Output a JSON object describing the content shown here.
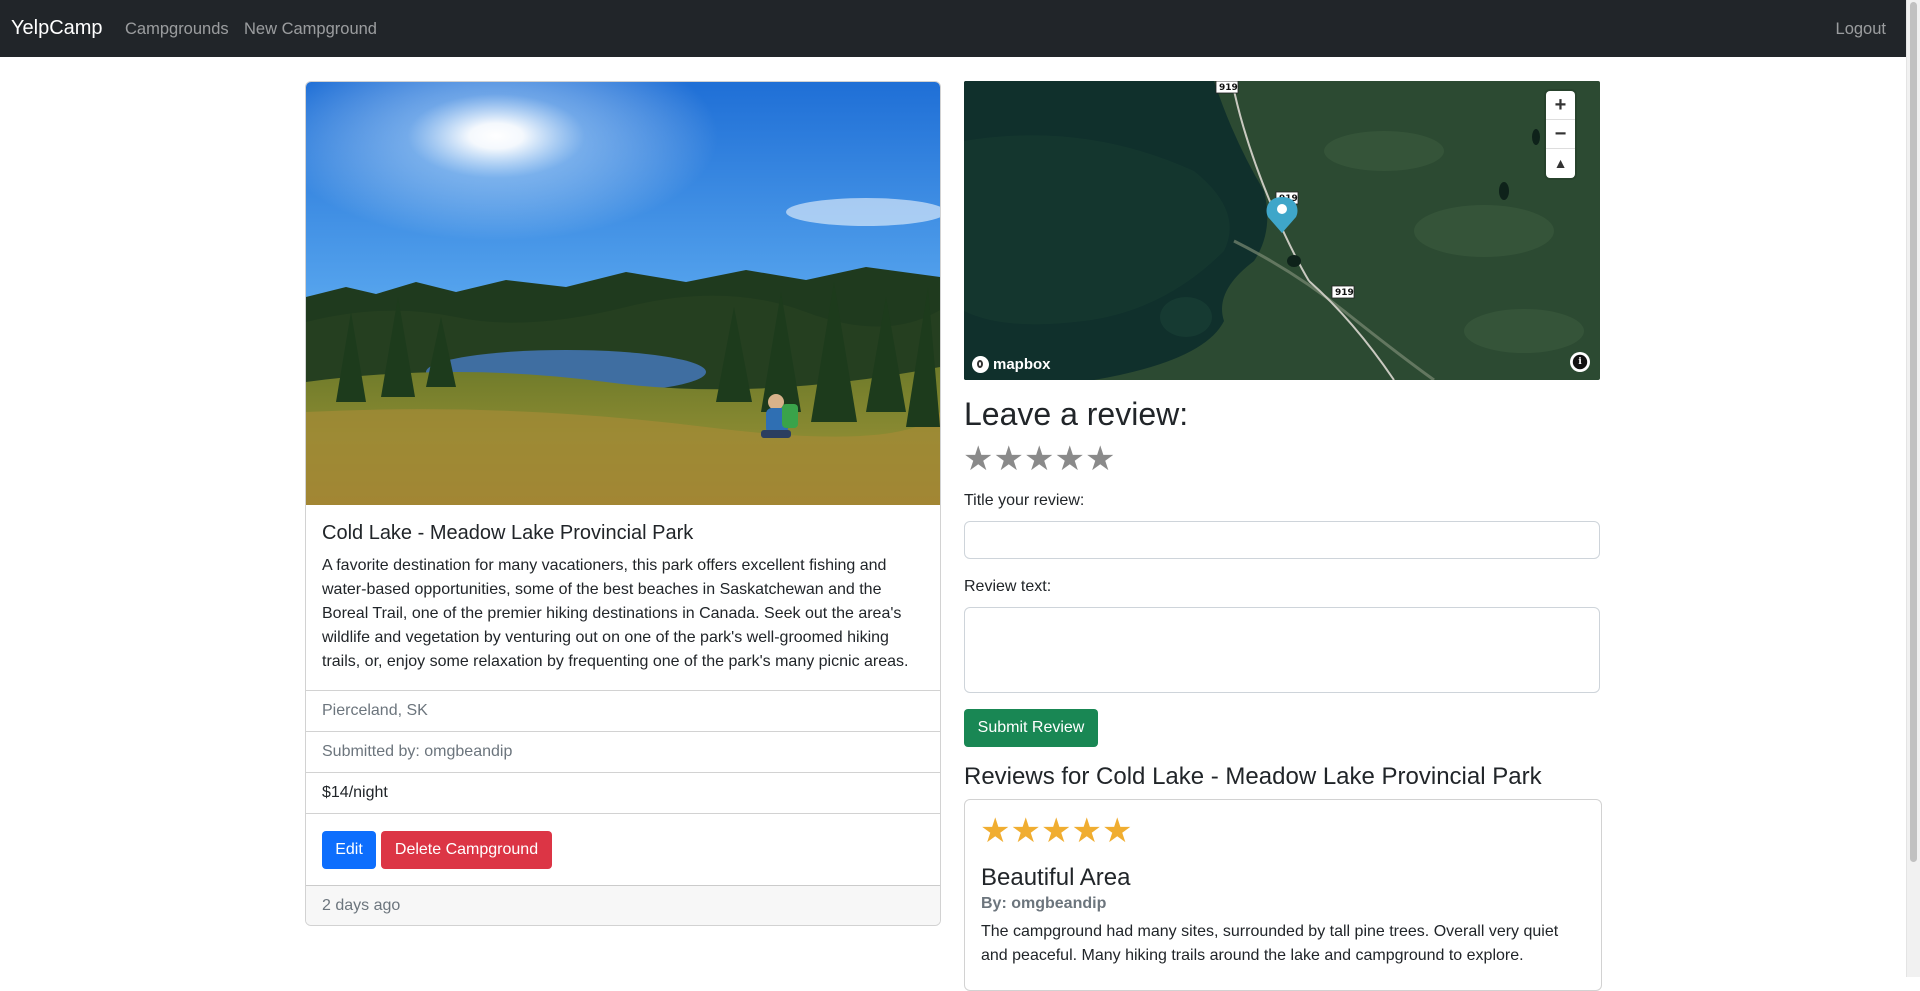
{
  "navbar": {
    "brand": "YelpCamp",
    "links": [
      "Campgrounds",
      "New Campground"
    ],
    "logout": "Logout"
  },
  "campground": {
    "title": "Cold Lake - Meadow Lake Provincial Park",
    "description": "A favorite destination for many vacationers, this park offers excellent fishing and water-based opportunities, some of the best beaches in Saskatchewan and the Boreal Trail, one of the premier hiking destinations in Canada. Seek out the area's wildlife and vegetation by venturing out on one of the park's well-groomed hiking trails, or, enjoy some relaxation by frequenting one of the park's many picnic areas.",
    "location": "Pierceland, SK",
    "submitted_by": "Submitted by: omgbeandip",
    "price": "$14/night",
    "edit_label": "Edit",
    "delete_label": "Delete Campground",
    "footer": "2 days ago"
  },
  "map": {
    "zoom_in": "+",
    "zoom_out": "−",
    "reset_north": "▲",
    "attribution": "mapbox",
    "road_labels": [
      "919",
      "919",
      "919"
    ]
  },
  "review_form": {
    "heading": "Leave a review:",
    "rating_stars": [
      "★",
      "★",
      "★",
      "★",
      "★"
    ],
    "title_label": "Title your review:",
    "text_label": "Review text:",
    "submit_label": "Submit Review"
  },
  "reviews": {
    "heading": "Reviews for Cold Lake - Meadow Lake Provincial Park",
    "items": [
      {
        "rating": 5,
        "stars": [
          "★",
          "★",
          "★",
          "★",
          "★"
        ],
        "title": "Beautiful Area",
        "author": "By: omgbeandip",
        "text": "The campground had many sites, surrounded by tall pine trees. Overall very quiet and peaceful. Many hiking trails around the lake and campground to explore."
      }
    ]
  },
  "colors": {
    "navbar": "#212529",
    "edit": "#0d6efd",
    "delete": "#dc3545",
    "submit": "#198754",
    "star_filled": "#f0ad30",
    "star_empty": "#8a8a8a"
  }
}
